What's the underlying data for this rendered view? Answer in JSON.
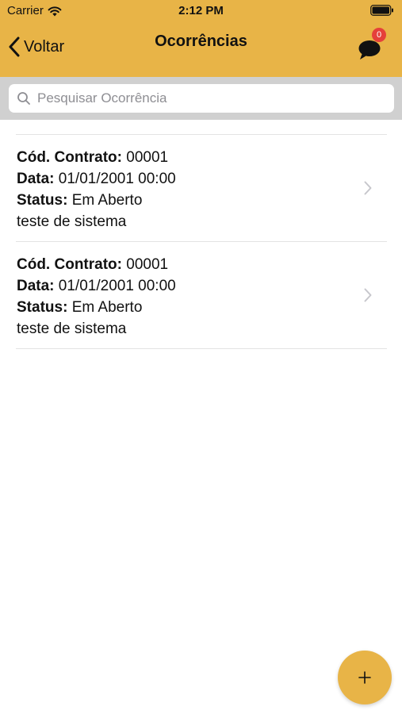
{
  "status_bar": {
    "carrier": "Carrier",
    "time": "2:12 PM"
  },
  "nav": {
    "back_label": "Voltar",
    "title": "Ocorrências",
    "chat_badge_count": "0"
  },
  "search": {
    "placeholder": "Pesquisar Ocorrência",
    "value": ""
  },
  "items": [
    {
      "contract_label": "Cód. Contrato:",
      "contract_value": "00001",
      "date_label": "Data:",
      "date_value": "01/01/2001 00:00",
      "status_label": "Status:",
      "status_value": "Em Aberto",
      "description": "teste de sistema"
    },
    {
      "contract_label": "Cód. Contrato:",
      "contract_value": "00001",
      "date_label": "Data:",
      "date_value": "01/01/2001 00:00",
      "status_label": "Status:",
      "status_value": "Em Aberto",
      "description": "teste de sistema"
    }
  ],
  "icons": {
    "status_wifi": "wifi-icon",
    "status_battery": "battery-icon",
    "back": "chevron-left-icon",
    "chat": "chat-bubble-icon",
    "search": "search-icon",
    "disclosure": "chevron-right-icon",
    "add": "plus-icon"
  },
  "colors": {
    "accent": "#e8b447",
    "badge": "#e5403a",
    "search_bar_background": "#d0d0d0",
    "placeholder": "#8e8e93"
  }
}
